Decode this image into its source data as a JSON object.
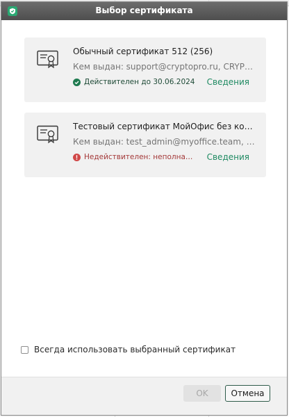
{
  "dialog": {
    "title": "Выбор сертификата"
  },
  "certificates": [
    {
      "name": "Обычный сертификат 512 (256)",
      "issuer": "Кем выдан: support@cryptopro.ru, CRYPTO-PRO",
      "status": "valid",
      "status_text": "Действителен до 30.06.2024",
      "details_label": "Сведения"
    },
    {
      "name": "Тестовый сертификат МойОфис без корневого",
      "issuer": "Кем выдан: test_admin@myoffice.team, MyOffice",
      "status": "invalid",
      "status_text": "Недействителен: неполная цепочка",
      "details_label": "Сведения"
    }
  ],
  "always_use": {
    "label": "Всегда использовать выбранный сертификат",
    "checked": false
  },
  "buttons": {
    "ok": "OK",
    "cancel": "Отмена"
  },
  "colors": {
    "title_bar": "#565656",
    "accent": "#1f8a62",
    "valid": "#1e7a4f",
    "invalid": "#d04848",
    "card_bg": "#f1f1f1"
  },
  "icons": {
    "app": "shield-check-icon",
    "certificate": "certificate-icon",
    "valid": "check-circle-icon",
    "invalid": "error-circle-icon"
  }
}
